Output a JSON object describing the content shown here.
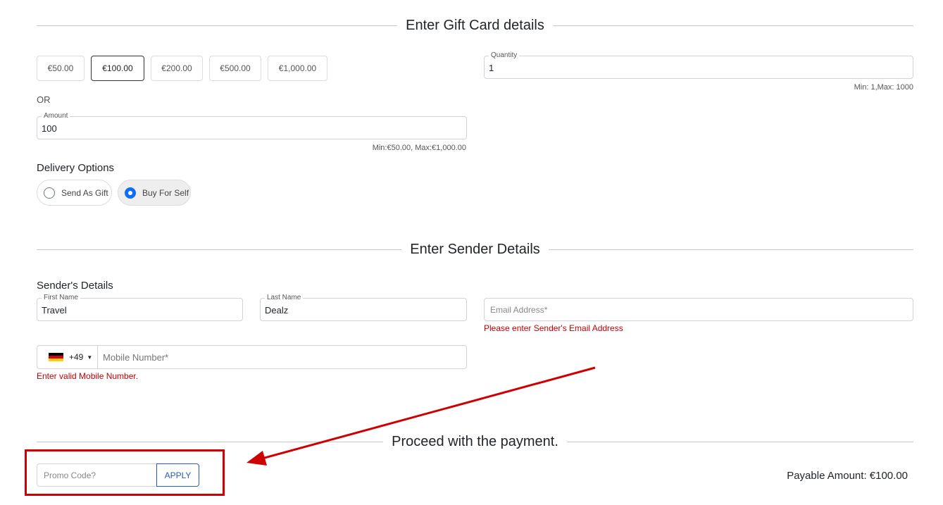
{
  "gift_card": {
    "title": "Enter Gift Card details",
    "denominations": [
      "€50.00",
      "€100.00",
      "€200.00",
      "€500.00",
      "€1,000.00"
    ],
    "selected_denomination": "€100.00",
    "quantity_label": "Quantity",
    "quantity_value": "1",
    "quantity_hint": "Min: 1,Max: 1000",
    "or_label": "OR",
    "amount_label": "Amount",
    "amount_value": "100",
    "amount_hint": "Min:€50.00, Max:€1,000.00",
    "delivery_heading": "Delivery Options",
    "delivery_options": [
      {
        "label": "Send As Gift",
        "checked": false
      },
      {
        "label": "Buy For Self",
        "checked": true
      }
    ]
  },
  "sender": {
    "title": "Enter Sender Details",
    "heading": "Sender's Details",
    "first_name_label": "First Name",
    "first_name_value": "Travel",
    "last_name_label": "Last Name",
    "last_name_value": "Dealz",
    "email_placeholder": "Email Address*",
    "email_error": "Please enter Sender's Email Address",
    "country_code": "+49",
    "mobile_placeholder": "Mobile Number*",
    "mobile_error": "Enter valid Mobile Number."
  },
  "payment": {
    "title": "Proceed with the payment.",
    "promo_placeholder": "Promo Code?",
    "apply_label": "APPLY",
    "payable_amount": "Payable Amount: €100.00"
  },
  "colors": {
    "accent_blue": "#0d6efd",
    "apply_blue": "#2a5db0",
    "error_red": "#c40000",
    "annotation_red": "#d10000"
  }
}
